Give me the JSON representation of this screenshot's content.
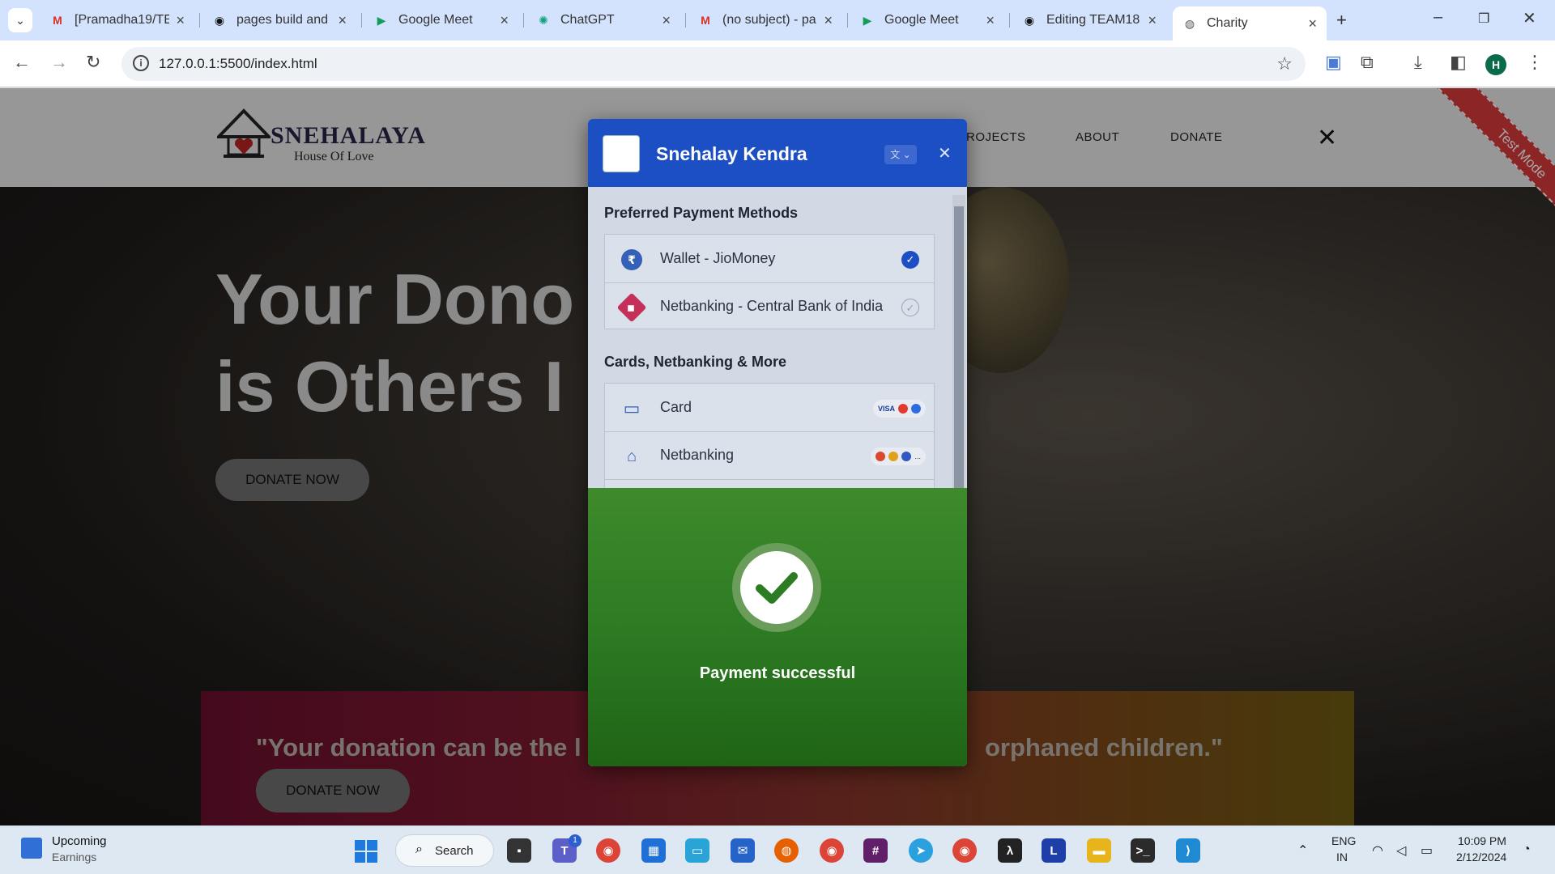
{
  "browser": {
    "tabs": [
      {
        "title": "[Pramadha19/TE",
        "icon": "gmail-icon",
        "active": false
      },
      {
        "title": "pages build and",
        "icon": "github-icon",
        "active": false
      },
      {
        "title": "Google Meet",
        "icon": "meet-icon",
        "active": false
      },
      {
        "title": "ChatGPT",
        "icon": "chatgpt-icon",
        "active": false
      },
      {
        "title": "(no subject) - pa",
        "icon": "gmail-icon",
        "active": false
      },
      {
        "title": "Google Meet",
        "icon": "meet-icon",
        "active": false
      },
      {
        "title": "Editing TEAM18",
        "icon": "github-icon",
        "active": false
      },
      {
        "title": "Charity",
        "icon": "globe-icon",
        "active": true
      }
    ],
    "url": "127.0.0.1:5500/index.html",
    "profile_initial": "H"
  },
  "site": {
    "logo_title": "SNEHALAYA",
    "logo_subtitle": "House Of Love",
    "nav": [
      "ROJECTS",
      "ABOUT",
      "DONATE"
    ],
    "ribbon": "Test Mode",
    "hero_line1": "Your Dono",
    "hero_line2": "is Others I",
    "donate_now": "DONATE NOW",
    "quote_left": "\"Your donation can be the l",
    "quote_right": "orphaned children.\""
  },
  "payment": {
    "merchant": "Snehalay Kendra",
    "lang_label": "文",
    "preferred_title": "Preferred Payment Methods",
    "preferred": [
      {
        "label": "Wallet - JioMoney",
        "icon": "rupee-wallet-icon",
        "selected": true
      },
      {
        "label": "Netbanking - Central Bank of India",
        "icon": "bank-logo-icon",
        "selected": false
      }
    ],
    "more_title": "Cards, Netbanking & More",
    "more": [
      {
        "label": "Card",
        "icon": "card-icon",
        "badges": "VISA"
      },
      {
        "label": "Netbanking",
        "icon": "bank-building-icon",
        "badges": "..."
      }
    ],
    "success_text": "Payment successful"
  },
  "taskbar": {
    "widget_title": "Upcoming",
    "widget_subtitle": "Earnings",
    "search_label": "Search",
    "lang_top": "ENG",
    "lang_bottom": "IN",
    "time": "10:09 PM",
    "date": "2/12/2024",
    "notification_badge": "1"
  },
  "colors": {
    "modal_header": "#1d4fc4",
    "success_green": "#2d7b23",
    "ribbon_red": "#d83b3b",
    "tab_strip": "#d3e3fd"
  }
}
